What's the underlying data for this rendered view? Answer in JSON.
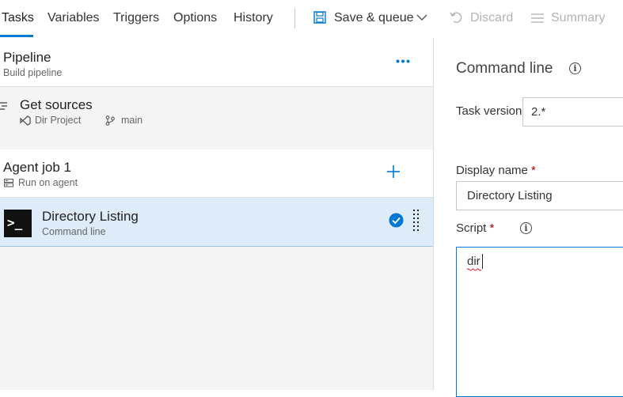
{
  "toolbar": {
    "tabs": [
      {
        "label": "Tasks"
      },
      {
        "label": "Variables"
      },
      {
        "label": "Triggers"
      },
      {
        "label": "Options"
      },
      {
        "label": "History"
      }
    ],
    "save_queue_label": "Save & queue",
    "discard_label": "Discard",
    "summary_label": "Summary"
  },
  "pipeline": {
    "title": "Pipeline",
    "subtitle": "Build pipeline",
    "more_glyph": "..."
  },
  "get_sources": {
    "title": "Get sources",
    "repo": "Dir Project",
    "branch": "main"
  },
  "agent_job": {
    "title": "Agent job 1",
    "subtitle": "Run on agent",
    "add_glyph": "+"
  },
  "task": {
    "title": "Directory Listing",
    "subtitle": "Command line",
    "icon_glyph": ">_"
  },
  "details": {
    "heading": "Command line",
    "task_version_label": "Task version",
    "task_version_value": "2.*",
    "display_name_label": "Display name",
    "display_name_value": "Directory Listing",
    "script_label": "Script",
    "script_value": "dir",
    "required_mark": "*",
    "info_glyph": "i"
  },
  "colors": {
    "accent": "#0078d4",
    "selected_row": "#deecf9",
    "required": "#a80000"
  }
}
